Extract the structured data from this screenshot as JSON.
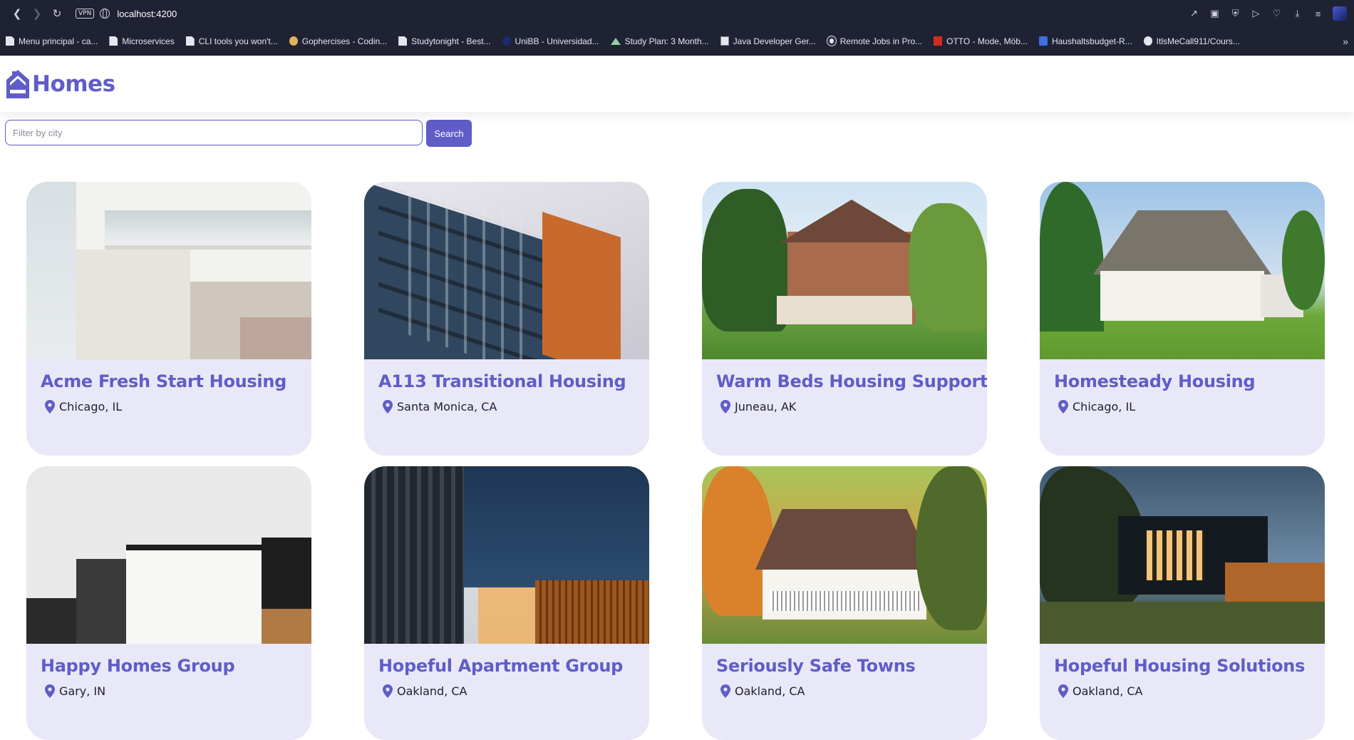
{
  "browser": {
    "url": "localhost:4200",
    "vpn_label": "VPN",
    "bookmarks": [
      {
        "label": "Menu principal - ca...",
        "icon": "doc"
      },
      {
        "label": "Microservices",
        "icon": "doc"
      },
      {
        "label": "CLI tools you won't...",
        "icon": "doc"
      },
      {
        "label": "Gophercises - Codin...",
        "icon": "gopher"
      },
      {
        "label": "Studytonight - Best...",
        "icon": "doc"
      },
      {
        "label": "UniBB - Universidad...",
        "icon": "unibb"
      },
      {
        "label": "Study Plan: 3 Month...",
        "icon": "mount"
      },
      {
        "label": "Java Developer Ger...",
        "icon": "java"
      },
      {
        "label": "Remote Jobs in Pro...",
        "icon": "remote"
      },
      {
        "label": "OTTO - Mode, Möb...",
        "icon": "otto"
      },
      {
        "label": "Haushaltsbudget-R...",
        "icon": "hh"
      },
      {
        "label": "ItlsMeCall911/Cours...",
        "icon": "gh"
      }
    ]
  },
  "header": {
    "title": "Homes",
    "brand_color": "#605dc8"
  },
  "search": {
    "placeholder": "Filter by city",
    "value": "",
    "button_label": "Search"
  },
  "listings": [
    {
      "name": "Acme Fresh Start Housing",
      "city": "Chicago, IL"
    },
    {
      "name": "A113 Transitional Housing",
      "city": "Santa Monica, CA"
    },
    {
      "name": "Warm Beds Housing Support",
      "city": "Juneau, AK"
    },
    {
      "name": "Homesteady Housing",
      "city": "Chicago, IL"
    },
    {
      "name": "Happy Homes Group",
      "city": "Gary, IN"
    },
    {
      "name": "Hopeful Apartment Group",
      "city": "Oakland, CA"
    },
    {
      "name": "Seriously Safe Towns",
      "city": "Oakland, CA"
    },
    {
      "name": "Hopeful Housing Solutions",
      "city": "Oakland, CA"
    }
  ]
}
